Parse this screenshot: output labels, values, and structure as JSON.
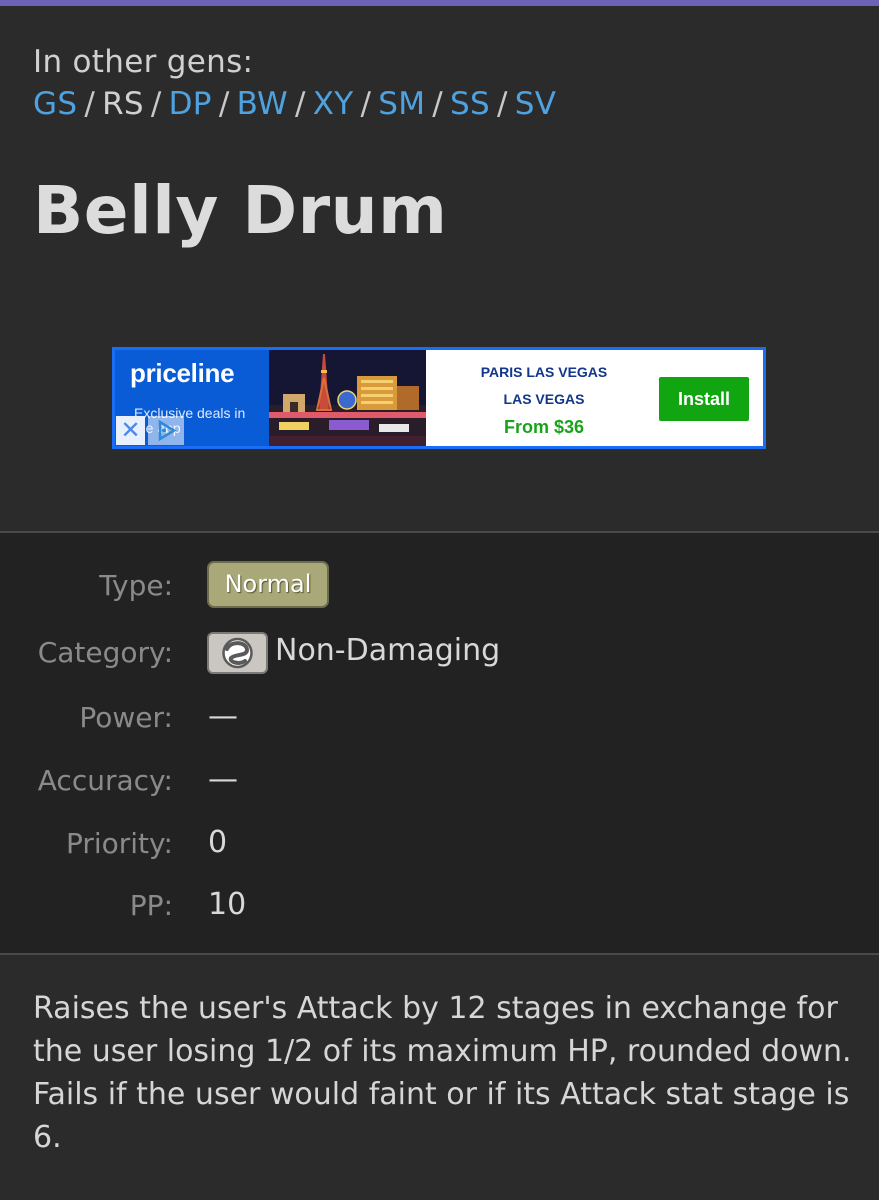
{
  "gens": {
    "label": "In other gens:",
    "items": [
      {
        "label": "GS",
        "link": true
      },
      {
        "label": "RS",
        "link": false
      },
      {
        "label": "DP",
        "link": true
      },
      {
        "label": "BW",
        "link": true
      },
      {
        "label": "XY",
        "link": true
      },
      {
        "label": "SM",
        "link": true
      },
      {
        "label": "SS",
        "link": true
      },
      {
        "label": "SV",
        "link": true
      }
    ],
    "separator": "/"
  },
  "move": {
    "title": "Belly Drum"
  },
  "ad": {
    "brand": "priceline",
    "tagline": "Exclusive deals in the app",
    "line1": "PARIS LAS VEGAS",
    "line2": "LAS VEGAS",
    "price": "From $36",
    "button": "Install",
    "close_glyph": "✕",
    "colors": {
      "brand_bg": "#0a5cd6",
      "border": "#1a6ef5",
      "button": "#12a512",
      "price": "#1aa31a"
    }
  },
  "info": {
    "type_label": "Type:",
    "type_value": "Normal",
    "type_color": "#a8a878",
    "category_label": "Category:",
    "category_value": "Non-Damaging",
    "category_icon": "status-category-icon",
    "power_label": "Power:",
    "power_value": "—",
    "accuracy_label": "Accuracy:",
    "accuracy_value": "—",
    "priority_label": "Priority:",
    "priority_value": "0",
    "pp_label": "PP:",
    "pp_value": "10"
  },
  "description": "Raises the user's Attack by 12 stages in exchange for the user losing 1/2 of its maximum HP, rounded down. Fails if the user would faint or if its Attack stat stage is 6.",
  "colors": {
    "background": "#2b2b2b",
    "panel": "#222222",
    "link": "#4ea2e0",
    "accent_bar": "#6b63b5"
  }
}
